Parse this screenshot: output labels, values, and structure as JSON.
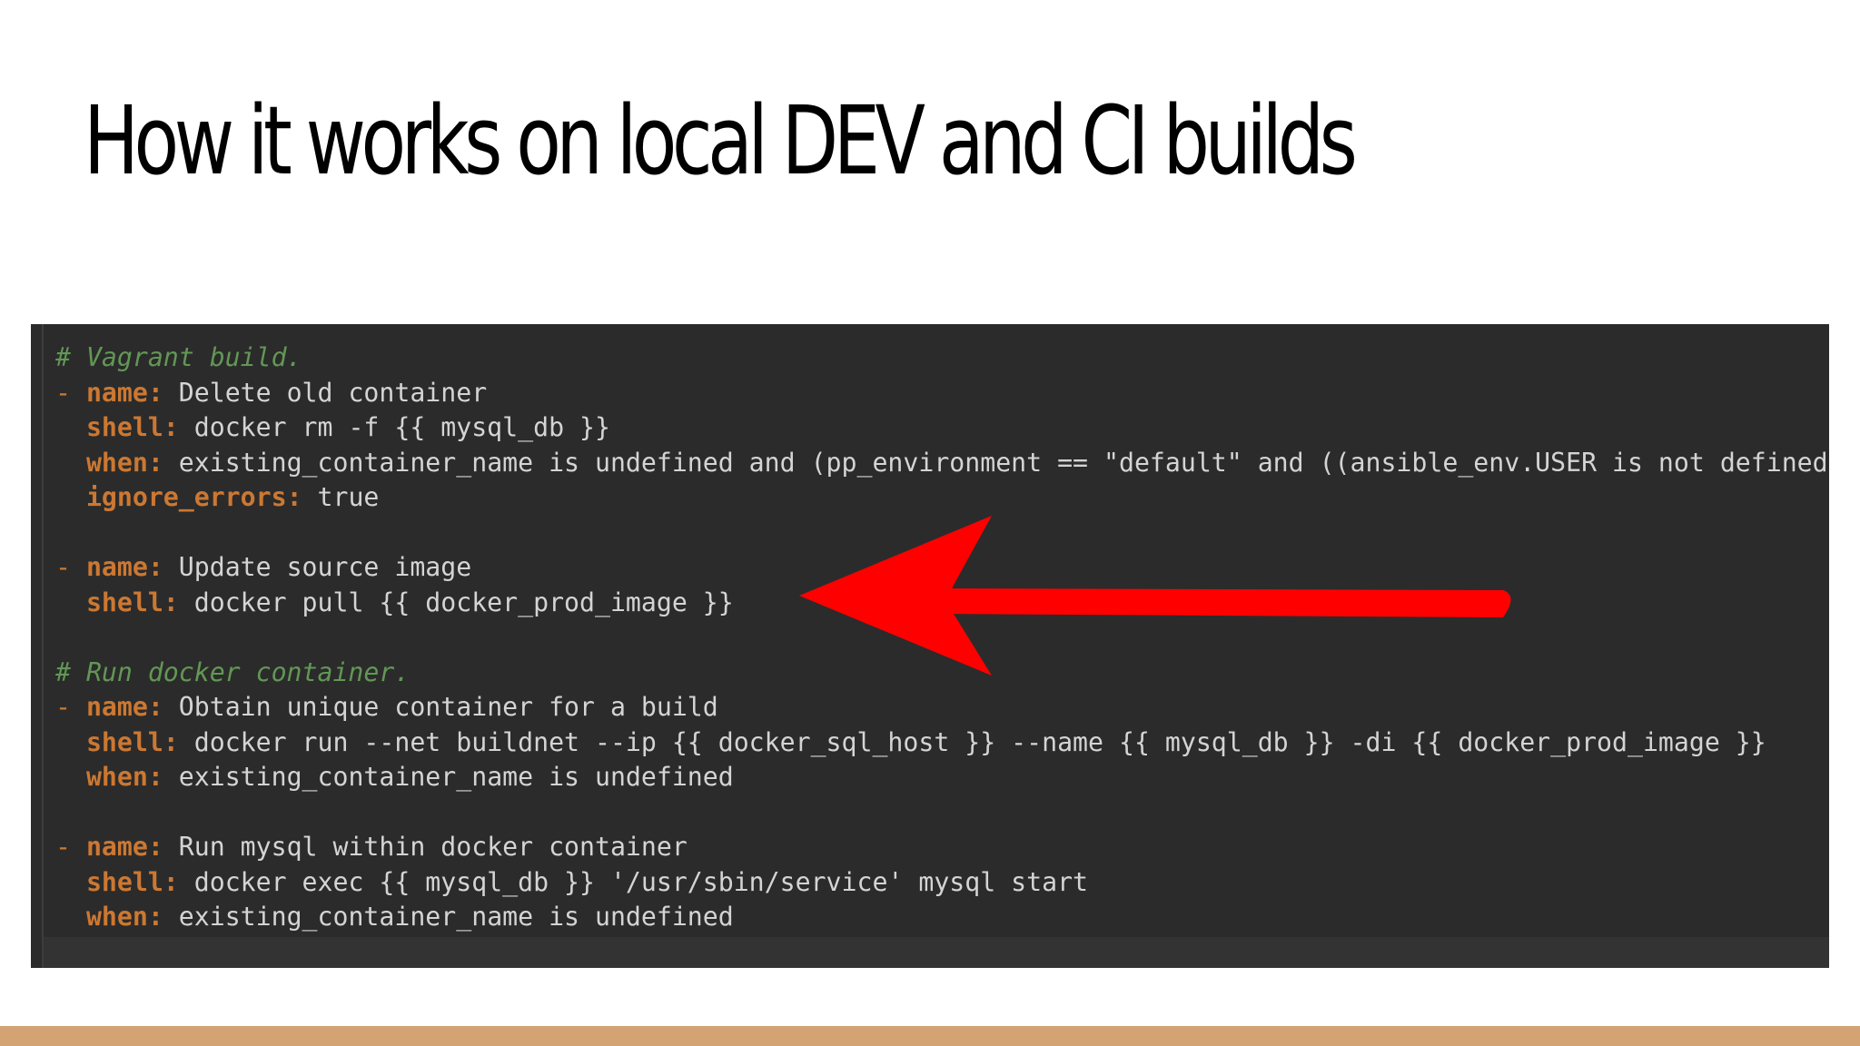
{
  "slide": {
    "title": "How it works on local DEV and CI builds"
  },
  "code_screenshot": {
    "lines": [
      {
        "type": "comment",
        "text": "# Vagrant build."
      },
      {
        "type": "kv",
        "dash": "- ",
        "key": "name:",
        "value": " Delete old container"
      },
      {
        "type": "kv",
        "dash": "  ",
        "key": "shell:",
        "value": " docker rm -f {{ mysql_db }}"
      },
      {
        "type": "kv",
        "dash": "  ",
        "key": "when:",
        "value": " existing_container_name is undefined and (pp_environment == \"default\" and ((ansible_env.USER is not defined"
      },
      {
        "type": "kv",
        "dash": "  ",
        "key": "ignore_errors:",
        "value": " true"
      },
      {
        "type": "blank",
        "text": ""
      },
      {
        "type": "kv",
        "dash": "- ",
        "key": "name:",
        "value": " Update source image"
      },
      {
        "type": "kv",
        "dash": "  ",
        "key": "shell:",
        "value": " docker pull {{ docker_prod_image }}"
      },
      {
        "type": "blank",
        "text": ""
      },
      {
        "type": "comment",
        "text": "# Run docker container."
      },
      {
        "type": "kv",
        "dash": "- ",
        "key": "name:",
        "value": " Obtain unique container for a build"
      },
      {
        "type": "kv",
        "dash": "  ",
        "key": "shell:",
        "value": " docker run --net buildnet --ip {{ docker_sql_host }} --name {{ mysql_db }} -di {{ docker_prod_image }}"
      },
      {
        "type": "kv",
        "dash": "  ",
        "key": "when:",
        "value": " existing_container_name is undefined"
      },
      {
        "type": "blank",
        "text": ""
      },
      {
        "type": "kv",
        "dash": "- ",
        "key": "name:",
        "value": " Run mysql within docker container"
      },
      {
        "type": "kv",
        "dash": "  ",
        "key": "shell:",
        "value": " docker exec {{ mysql_db }} '/usr/sbin/service' mysql start"
      },
      {
        "type": "kv",
        "dash": "  ",
        "key": "when:",
        "value": " existing_container_name is undefined"
      }
    ]
  },
  "annotation": {
    "icon": "left-arrow-icon",
    "color": "#ff0000"
  },
  "theme": {
    "footer_color": "#d4a373",
    "code_background": "#2b2b2b",
    "keyword_color": "#cc7832",
    "comment_color": "#629755"
  }
}
